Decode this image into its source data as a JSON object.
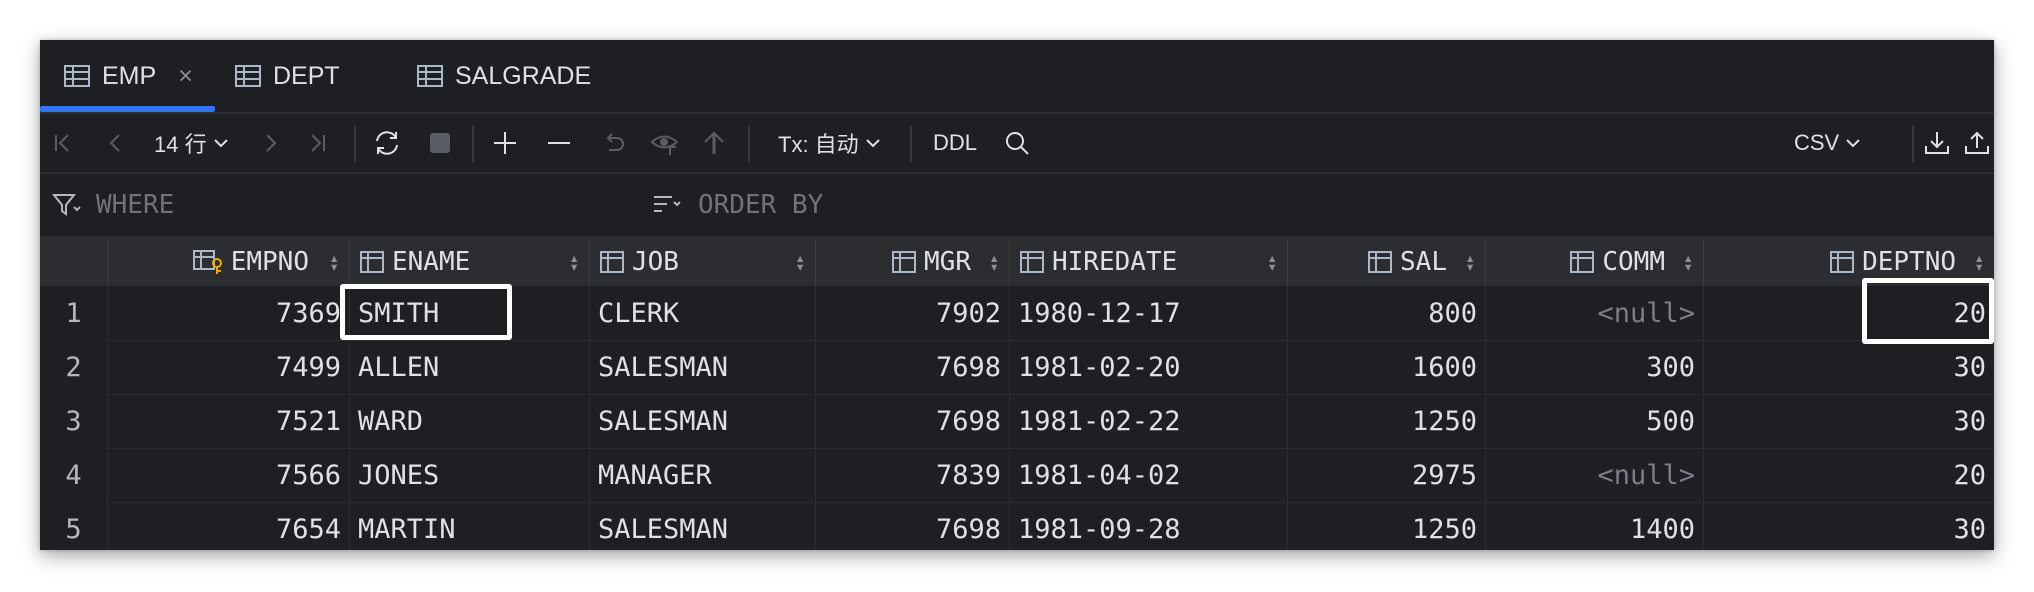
{
  "tabs": [
    {
      "label": "EMP",
      "active": true,
      "close": "×"
    },
    {
      "label": "DEPT",
      "active": false
    },
    {
      "label": "SALGRADE",
      "active": false
    }
  ],
  "toolbar": {
    "rows_label": "14 行",
    "tx_label": "Tx: 自动",
    "ddl_label": "DDL",
    "export_format": "CSV"
  },
  "filter": {
    "where_placeholder": "WHERE",
    "orderby_placeholder": "ORDER BY"
  },
  "columns": [
    "EMPNO",
    "ENAME",
    "JOB",
    "MGR",
    "HIREDATE",
    "SAL",
    "COMM",
    "DEPTNO"
  ],
  "rows": [
    {
      "n": "1",
      "empno": "7369",
      "ename": "SMITH",
      "job": "CLERK",
      "mgr": "7902",
      "hiredate": "1980-12-17",
      "sal": "800",
      "comm": "<null>",
      "deptno": "20"
    },
    {
      "n": "2",
      "empno": "7499",
      "ename": "ALLEN",
      "job": "SALESMAN",
      "mgr": "7698",
      "hiredate": "1981-02-20",
      "sal": "1600",
      "comm": "300",
      "deptno": "30"
    },
    {
      "n": "3",
      "empno": "7521",
      "ename": "WARD",
      "job": "SALESMAN",
      "mgr": "7698",
      "hiredate": "1981-02-22",
      "sal": "1250",
      "comm": "500",
      "deptno": "30"
    },
    {
      "n": "4",
      "empno": "7566",
      "ename": "JONES",
      "job": "MANAGER",
      "mgr": "7839",
      "hiredate": "1981-04-02",
      "sal": "2975",
      "comm": "<null>",
      "deptno": "20"
    },
    {
      "n": "5",
      "empno": "7654",
      "ename": "MARTIN",
      "job": "SALESMAN",
      "mgr": "7698",
      "hiredate": "1981-09-28",
      "sal": "1250",
      "comm": "1400",
      "deptno": "30"
    }
  ],
  "colors": {
    "accent": "#3574f0",
    "background": "#1e1f22",
    "header": "#2b2d30",
    "highlight": "#ffffff"
  }
}
